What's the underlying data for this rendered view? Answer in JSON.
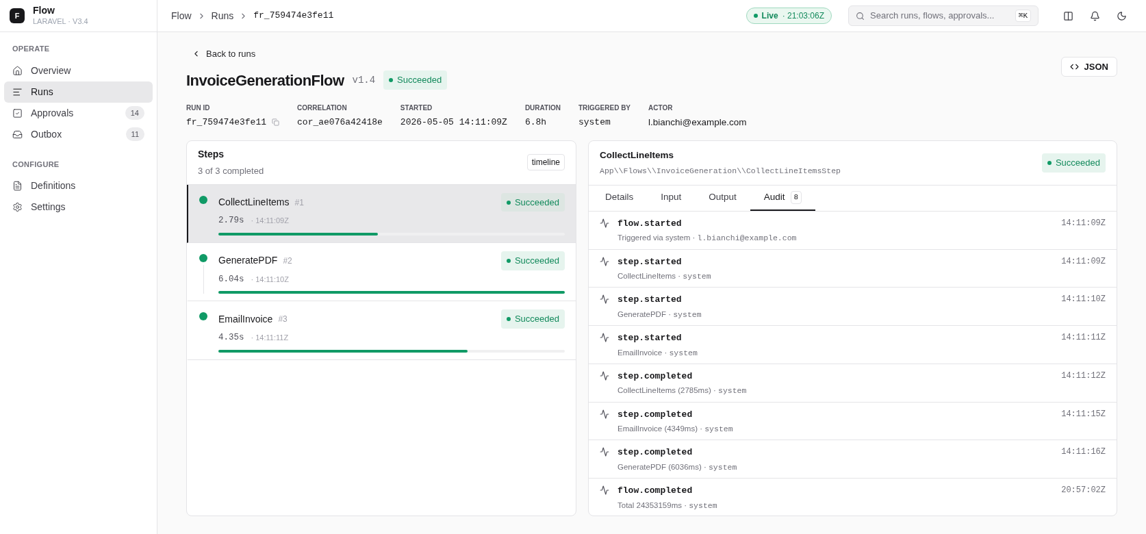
{
  "brand": {
    "logo": "F",
    "name": "Flow",
    "subtitle": "LARAVEL · V3.4"
  },
  "sidebar": {
    "sections": [
      {
        "title": "OPERATE",
        "items": [
          {
            "label": "Overview",
            "selected": false
          },
          {
            "label": "Runs",
            "selected": true
          },
          {
            "label": "Approvals",
            "selected": false,
            "badge": "14"
          },
          {
            "label": "Outbox",
            "selected": false,
            "badge": "11"
          }
        ]
      },
      {
        "title": "CONFIGURE",
        "items": [
          {
            "label": "Definitions",
            "selected": false
          },
          {
            "label": "Settings",
            "selected": false
          }
        ]
      }
    ]
  },
  "breadcrumbs": [
    "Flow",
    "Runs",
    "fr_759474e3fe11"
  ],
  "live": {
    "label": "Live",
    "time": "· 21:03:06Z"
  },
  "search": {
    "placeholder": "Search runs, flows, approvals...",
    "shortcut": "⌘K"
  },
  "back_link": "Back to runs",
  "json_button": "JSON",
  "run": {
    "title": "InvoiceGenerationFlow",
    "version": "v1.4",
    "status": {
      "label": "Succeeded"
    }
  },
  "meta": [
    {
      "label": "RUN ID",
      "value": "fr_759474e3fe11",
      "copy": true,
      "sans": false
    },
    {
      "label": "CORRELATION",
      "value": "cor_ae076a42418e",
      "copy": false,
      "sans": false
    },
    {
      "label": "STARTED",
      "value": "2026-05-05 14:11:09Z",
      "copy": false,
      "sans": false
    },
    {
      "label": "DURATION",
      "value": "6.8h",
      "copy": false,
      "sans": false
    },
    {
      "label": "TRIGGERED BY",
      "value": "system",
      "copy": false,
      "sans": false
    },
    {
      "label": "ACTOR",
      "value": "l.bianchi@example.com",
      "copy": false,
      "sans": true
    }
  ],
  "steps": {
    "title": "Steps",
    "subtitle": "3 of 3 completed",
    "view": "timeline",
    "items": [
      {
        "name": "CollectLineItems",
        "index": "#1",
        "duration": "2.79s",
        "time": "· 14:11:09Z",
        "status": {
          "label": "Succeeded"
        },
        "level": 0.46,
        "selected": true
      },
      {
        "name": "GeneratePDF",
        "index": "#2",
        "duration": "6.04s",
        "time": "· 14:11:10Z",
        "status": {
          "label": "Succeeded"
        },
        "level": 1,
        "selected": false
      },
      {
        "name": "EmailInvoice",
        "index": "#3",
        "duration": "4.35s",
        "time": "· 14:11:11Z",
        "status": {
          "label": "Succeeded"
        },
        "level": 0.72,
        "selected": false
      }
    ]
  },
  "detail": {
    "title": "CollectLineItems",
    "class_path": "App\\\\Flows\\\\InvoiceGeneration\\\\CollectLineItemsStep",
    "status": {
      "label": "Succeeded"
    },
    "tabs": [
      {
        "label": "Details",
        "selected": false
      },
      {
        "label": "Input",
        "selected": false
      },
      {
        "label": "Output",
        "selected": false
      },
      {
        "label": "Audit",
        "selected": true,
        "count": "8"
      }
    ],
    "audit": [
      {
        "event": "flow.started",
        "detail": "Triggered via system ·",
        "actor": "l.bianchi@example.com",
        "time": "14:11:09Z"
      },
      {
        "event": "step.started",
        "detail": "CollectLineItems ·",
        "actor": "system",
        "time": "14:11:09Z"
      },
      {
        "event": "step.started",
        "detail": "GeneratePDF ·",
        "actor": "system",
        "time": "14:11:10Z"
      },
      {
        "event": "step.started",
        "detail": "EmailInvoice ·",
        "actor": "system",
        "time": "14:11:11Z"
      },
      {
        "event": "step.completed",
        "detail": "CollectLineItems (2785ms) ·",
        "actor": "system",
        "time": "14:11:12Z"
      },
      {
        "event": "step.completed",
        "detail": "EmailInvoice (4349ms) ·",
        "actor": "system",
        "time": "14:11:15Z"
      },
      {
        "event": "step.completed",
        "detail": "GeneratePDF (6036ms) ·",
        "actor": "system",
        "time": "14:11:16Z"
      },
      {
        "event": "flow.completed",
        "detail": "Total 24353159ms ·",
        "actor": "system",
        "time": "20:57:02Z"
      }
    ]
  }
}
